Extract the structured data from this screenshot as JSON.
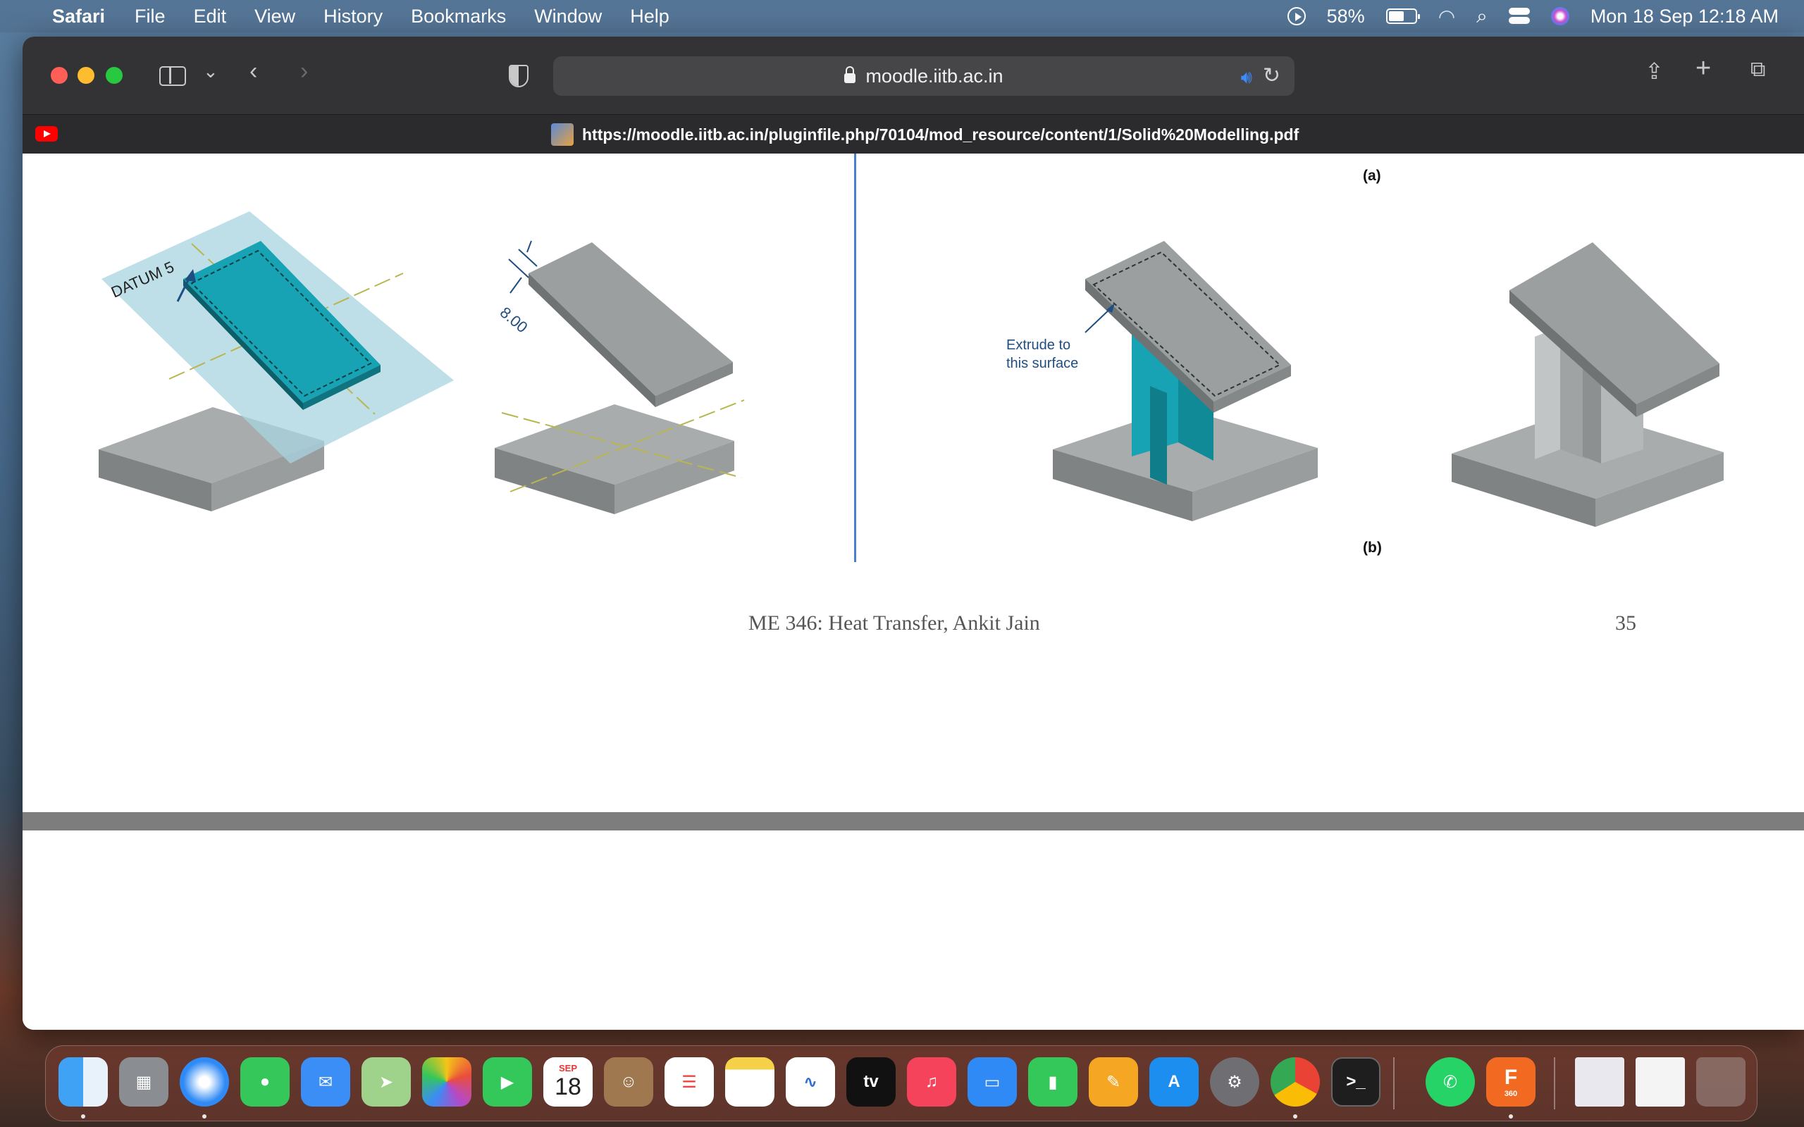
{
  "menubar": {
    "app_name": "Safari",
    "menus": [
      "File",
      "Edit",
      "View",
      "History",
      "Bookmarks",
      "Window",
      "Help"
    ],
    "battery_percent": "58%",
    "battery_level": 0.58,
    "datetime": "Mon 18 Sep  12:18 AM"
  },
  "browser": {
    "address": "moodle.iitb.ac.in",
    "tab_url": "https://moodle.iitb.ac.in/pluginfile.php/70104/mod_resource/content/1/Solid%20Modelling.pdf"
  },
  "pdf": {
    "label_a": "(a)",
    "label_b": "(b)",
    "datum_label": "DATUM 5",
    "dimension_label": "8.00",
    "extrude_label_line1": "Extrude to",
    "extrude_label_line2": "this surface",
    "footer": "ME 346: Heat Transfer, Ankit Jain",
    "page_number": "35"
  },
  "dock": {
    "calendar_month": "SEP",
    "calendar_day": "18",
    "tv_label": "tv",
    "fusion_label": "F",
    "fusion_sub": "360"
  },
  "colors": {
    "teal": "#17a3b3",
    "gray_block": "#8d9192",
    "datum_plane": "#a8d4e0",
    "annotation_blue": "#1f4e80"
  }
}
